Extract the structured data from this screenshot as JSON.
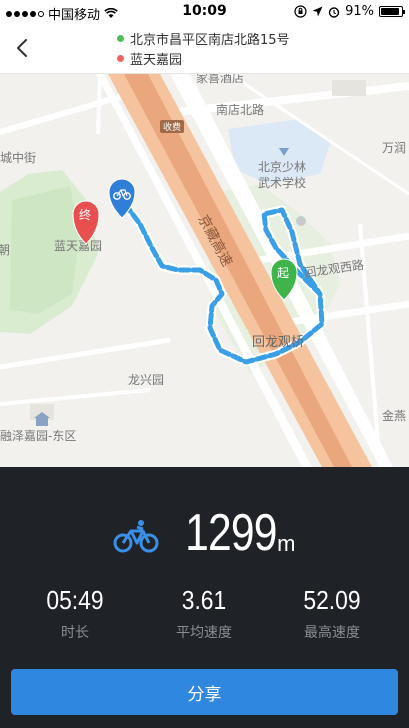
{
  "status_bar": {
    "carrier": "中国移动",
    "time": "10:09",
    "battery": "91%",
    "battery_level": 0.91
  },
  "header": {
    "start_address": "北京市昌平区南店北路15号",
    "end_address": "蓝天嘉园",
    "start_dot_color": "#4cc152",
    "end_dot_color": "#f06363"
  },
  "map": {
    "labels": {
      "nandian_north_road": "南店北路",
      "jia_ri": "家喜酒店",
      "school": "北京少林\n武术学校",
      "wanrun": "万润",
      "highway": "京藏高速",
      "huilongguan_road": "回龙观西路",
      "huilongguan_bridge": "回龙观桥",
      "lantian": "蓝天嘉园",
      "longxing": "龙兴园",
      "rongze": "融泽嘉园-东区",
      "jinyan": "金燕",
      "cheng_zhong": "城中街",
      "zhao": "朝",
      "toll": "收费"
    },
    "start_marker": "起",
    "end_marker": "终"
  },
  "summary": {
    "distance_value": "1299",
    "distance_unit": "m",
    "stats": [
      {
        "value": "05:49",
        "label": "时长"
      },
      {
        "value": "3.61",
        "label": "平均速度"
      },
      {
        "value": "52.09",
        "label": "最高速度"
      }
    ],
    "share_label": "分享",
    "accent_color": "#2f87e0"
  }
}
